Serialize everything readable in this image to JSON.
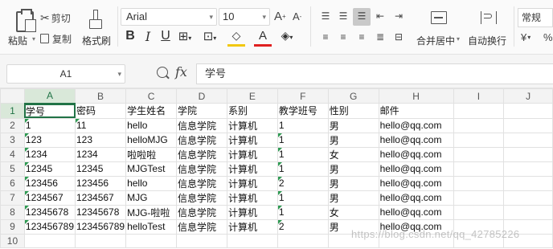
{
  "toolbar": {
    "paste_label": "粘贴",
    "cut_label": "剪切",
    "copy_label": "复制",
    "format_painter_label": "格式刷",
    "font_name": "Arial",
    "font_size": "10",
    "merge_center_label": "合并居中",
    "wrap_text_label": "自动换行",
    "number_format": "常规",
    "currency_symbol": "¥",
    "percent_symbol": "%"
  },
  "formula_bar": {
    "cell_ref": "A1",
    "fx_label": "fx",
    "content": "学号"
  },
  "grid": {
    "columns": [
      "A",
      "B",
      "C",
      "D",
      "E",
      "F",
      "G",
      "H",
      "I",
      "J"
    ],
    "rows": [
      {
        "num": "1",
        "cells": [
          "学号",
          "密码",
          "学生姓名",
          "学院",
          "系别",
          "教学班号",
          "性别",
          "邮件",
          "",
          ""
        ]
      },
      {
        "num": "2",
        "cells": [
          "1",
          "11",
          "hello",
          "信息学院",
          "计算机",
          "1",
          "男",
          "hello@qq.com",
          "",
          ""
        ]
      },
      {
        "num": "3",
        "cells": [
          "123",
          "123",
          "helloMJG",
          "信息学院",
          "计算机",
          "1",
          "男",
          "hello@qq.com",
          "",
          ""
        ]
      },
      {
        "num": "4",
        "cells": [
          "1234",
          "1234",
          "啦啦啦",
          "信息学院",
          "计算机",
          "1",
          "女",
          "hello@qq.com",
          "",
          ""
        ]
      },
      {
        "num": "5",
        "cells": [
          "12345",
          "12345",
          "MJGTest",
          "信息学院",
          "计算机",
          "1",
          "男",
          "hello@qq.com",
          "",
          ""
        ]
      },
      {
        "num": "6",
        "cells": [
          "123456",
          "123456",
          "hello",
          "信息学院",
          "计算机",
          "2",
          "男",
          "hello@qq.com",
          "",
          ""
        ]
      },
      {
        "num": "7",
        "cells": [
          "1234567",
          "1234567",
          "MJG",
          "信息学院",
          "计算机",
          "1",
          "男",
          "hello@qq.com",
          "",
          ""
        ]
      },
      {
        "num": "8",
        "cells": [
          "12345678",
          "12345678",
          "MJG-啦啦",
          "信息学院",
          "计算机",
          "1",
          "女",
          "hello@qq.com",
          "",
          ""
        ]
      },
      {
        "num": "9",
        "cells": [
          "123456789",
          "123456789",
          "helloTest",
          "信息学院",
          "计算机",
          "2",
          "男",
          "hello@qq.com",
          "",
          ""
        ]
      },
      {
        "num": "10",
        "cells": [
          "",
          "",
          "",
          "",
          "",
          "",
          "",
          "",
          "",
          ""
        ]
      }
    ]
  },
  "watermark": "https://blog.csdn.net/qq_42785226",
  "colors": {
    "accent": "#217346",
    "triangle": "#2e9a52"
  }
}
